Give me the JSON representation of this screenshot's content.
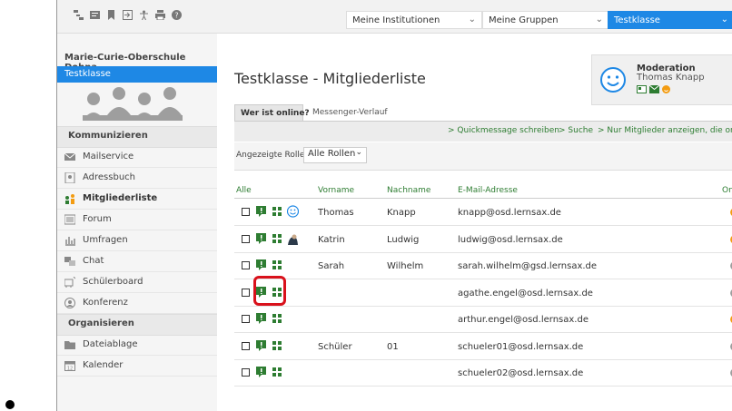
{
  "toolbar": {
    "icons": [
      "hierarchy-icon",
      "card-icon",
      "bookmark-icon",
      "login-icon",
      "accessibility-icon",
      "print-icon",
      "help-icon"
    ],
    "dropdowns": [
      {
        "label": "Meine Institutionen"
      },
      {
        "label": "Meine Gruppen"
      },
      {
        "label": "Testklasse"
      }
    ]
  },
  "sidebar": {
    "school": "Marie-Curie-Oberschule Dohna",
    "class_name": "Testklasse",
    "section1": "Kommunizieren",
    "items1": [
      {
        "label": "Mailservice",
        "icon": "mail-icon"
      },
      {
        "label": "Adressbuch",
        "icon": "addressbook-icon"
      },
      {
        "label": "Mitgliederliste",
        "icon": "members-icon"
      },
      {
        "label": "Forum",
        "icon": "forum-icon"
      },
      {
        "label": "Umfragen",
        "icon": "poll-icon"
      },
      {
        "label": "Chat",
        "icon": "chat-icon"
      },
      {
        "label": "Schülerboard",
        "icon": "board-icon"
      },
      {
        "label": "Konferenz",
        "icon": "conference-icon"
      }
    ],
    "section2": "Organisieren",
    "items2": [
      {
        "label": "Dateiablage",
        "icon": "folder-icon"
      },
      {
        "label": "Kalender",
        "icon": "calendar-icon"
      }
    ]
  },
  "main": {
    "title": "Testklasse - Mitgliederliste",
    "moderation": {
      "title": "Moderation",
      "name": "Thomas Knapp"
    },
    "tabs": [
      "Wer ist online?",
      "Messenger-Verlauf"
    ],
    "actions": [
      "> Quickmessage schreiben",
      "> Suche",
      "> Nur Mitglieder anzeigen, die online sind"
    ],
    "role_label": "Angezeigte Rolle",
    "role_value": "Alle Rollen",
    "headers": {
      "all": "Alle",
      "first": "Vorname",
      "last": "Nachname",
      "email": "E-Mail-Adresse",
      "online": "Online"
    },
    "rows": [
      {
        "first": "Thomas",
        "last": "Knapp",
        "email": "knapp@osd.lernsax.de",
        "status": "online",
        "avatar": "smiley"
      },
      {
        "first": "Katrin",
        "last": "Ludwig",
        "email": "ludwig@osd.lernsax.de",
        "status": "online",
        "avatar": "photo"
      },
      {
        "first": "Sarah",
        "last": "Wilhelm",
        "email": "sarah.wilhelm@gsd.lernsax.de",
        "status": "offline",
        "avatar": ""
      },
      {
        "first": "",
        "last": "",
        "email": "agathe.engel@osd.lernsax.de",
        "status": "offline",
        "avatar": ""
      },
      {
        "first": "",
        "last": "",
        "email": "arthur.engel@osd.lernsax.de",
        "status": "online",
        "avatar": ""
      },
      {
        "first": "Schüler",
        "last": "01",
        "email": "schueler01@osd.lernsax.de",
        "status": "offline",
        "avatar": ""
      },
      {
        "first": "",
        "last": "",
        "email": "schueler02@osd.lernsax.de",
        "status": "offline",
        "avatar": ""
      }
    ]
  },
  "colors": {
    "accent": "#1e88e5",
    "green": "#2e7d32",
    "online": "#f39c12",
    "offline": "#9e9e9e",
    "highlight": "#d9111b"
  }
}
